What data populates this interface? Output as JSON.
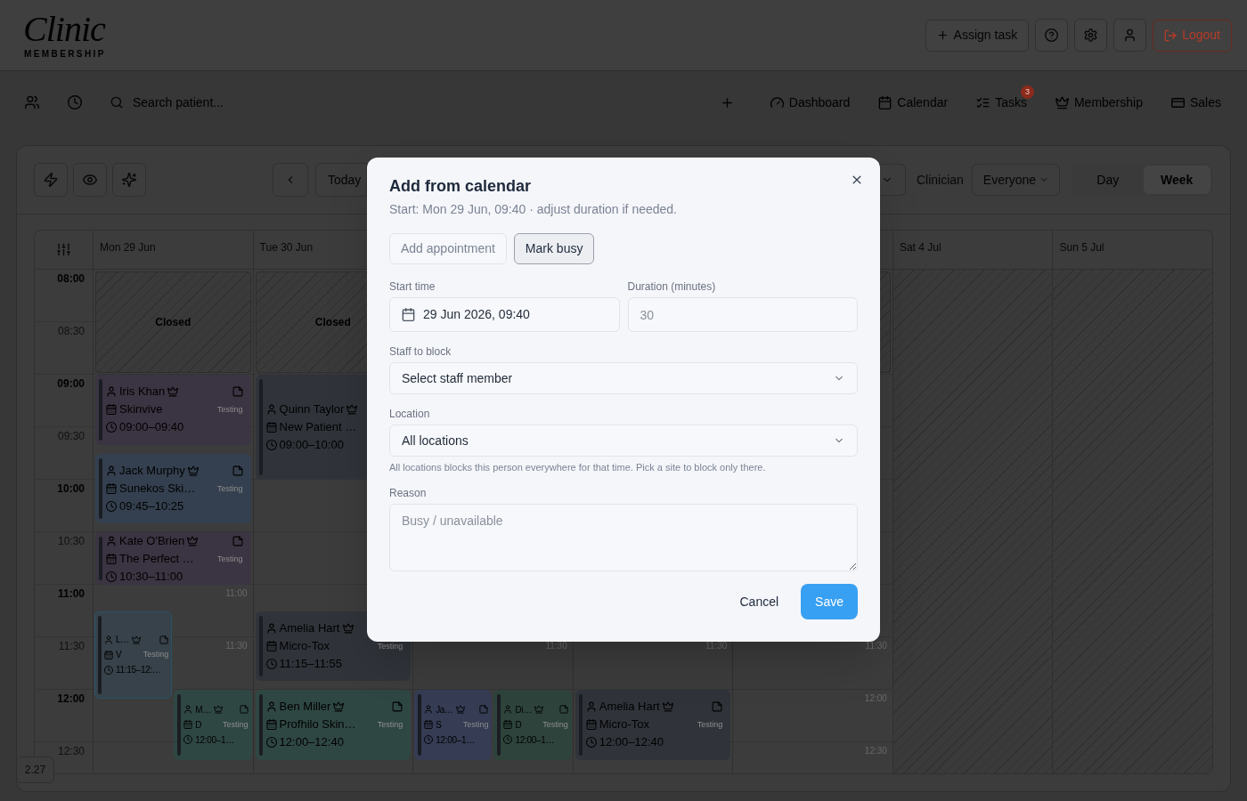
{
  "header": {
    "logo": {
      "wordmark": "Clinic",
      "tagline": "MEMBERSHIP"
    },
    "actions": [
      {
        "kind": "assign",
        "label": "Assign task"
      },
      {
        "kind": "help"
      },
      {
        "kind": "settings"
      },
      {
        "kind": "account"
      },
      {
        "kind": "logout",
        "label": "Logout"
      }
    ]
  },
  "nav": {
    "left": [
      {
        "kind": "patients"
      },
      {
        "kind": "history"
      }
    ],
    "search": {
      "placeholder": "Search patient..."
    },
    "links": [
      {
        "kind": "add"
      },
      {
        "kind": "dashboard",
        "label": "Dashboard"
      },
      {
        "kind": "calendar",
        "label": "Calendar"
      },
      {
        "kind": "tasks",
        "label": "Tasks",
        "badge": "3"
      },
      {
        "kind": "membership",
        "label": "Membership"
      },
      {
        "kind": "sales",
        "label": "Sales"
      }
    ]
  },
  "toolbar": {
    "tools": [
      {
        "kind": "quick-actions"
      },
      {
        "kind": "visibility"
      },
      {
        "kind": "ai"
      }
    ],
    "navigation": [
      {
        "kind": "prev"
      },
      {
        "kind": "today",
        "label": "Today"
      }
    ],
    "filters": [
      {
        "kind": "select"
      },
      {
        "kind": "label",
        "label": "Clinician"
      },
      {
        "kind": "select",
        "value": "Everyone"
      }
    ],
    "views": [
      {
        "label": "Day",
        "selected": false
      },
      {
        "label": "Week",
        "selected": true
      }
    ]
  },
  "calendar": {
    "times": [
      {
        "label": "08:00",
        "kind": "hour"
      },
      {
        "label": "08:30",
        "kind": "half"
      },
      {
        "label": "09:00",
        "kind": "hour"
      },
      {
        "label": "09:30",
        "kind": "half"
      },
      {
        "label": "10:00",
        "kind": "hour"
      },
      {
        "label": "10:30",
        "kind": "half"
      },
      {
        "label": "11:00",
        "kind": "hour"
      },
      {
        "label": "11:30",
        "kind": "half"
      },
      {
        "label": "12:00",
        "kind": "hour"
      },
      {
        "label": "12:30",
        "kind": "half"
      }
    ],
    "days": [
      {
        "label": "Mon 29 Jun",
        "closed_morning": true,
        "closed_label": "Closed",
        "slot_hints": [
          "11:00",
          "11:30"
        ],
        "events": [
          {
            "name": "Iris Khan",
            "member": true,
            "note": true,
            "treatment": "Skinvive",
            "tag": "Testing",
            "time": "09:00–09:40",
            "color": "#3b3442",
            "selected": false
          },
          {
            "name": "Jack Murphy",
            "member": true,
            "note": true,
            "treatment": "Sunekos Ski…",
            "tag": "Testing",
            "time": "09:45–10:25",
            "color": "#34404f",
            "selected": false
          },
          {
            "name": "Kate O'Brien",
            "member": true,
            "note": true,
            "treatment": "The Perfect …",
            "tag": "Testing",
            "time": "10:30–11:00",
            "color": "#3b3442",
            "selected": false
          },
          {
            "name": "L…",
            "member": true,
            "note": true,
            "treatment": "V",
            "tag": "Testing",
            "time": "11:15–12:…",
            "color": "#37424a",
            "selected": true
          },
          {
            "name": "M…",
            "member": true,
            "note": true,
            "treatment": "D",
            "tag": "Testing",
            "time": "12:00–1…",
            "color": "#2f4743",
            "selected": false
          }
        ]
      },
      {
        "label": "Tue 30 Jun",
        "closed_morning": true,
        "closed_label": "Closed",
        "events": [
          {
            "name": "Quinn Taylor",
            "member": true,
            "treatment": "New Patient …",
            "time": "09:00–10:00",
            "color": "#30343a",
            "selected": false
          },
          {
            "name": "Amelia Hart",
            "member": true,
            "treatment": "Micro-Tox",
            "tag": "Testing",
            "time": "11:15–11:55",
            "color": "#30343a",
            "selected": false
          },
          {
            "name": "Ben Miller",
            "member": true,
            "note": true,
            "treatment": "Profhilo Skin…",
            "tag": "Testing",
            "time": "12:00–12:40",
            "color": "#2f4743",
            "selected": false
          }
        ]
      },
      {
        "slot_hints": [
          "11:30"
        ],
        "events": [
          {
            "name": "Ja…",
            "member": true,
            "note": true,
            "treatment": "S",
            "tag": "Testing",
            "time": "12:00–1…",
            "color": "#353c53",
            "selected": false
          },
          {
            "name": "Di…",
            "member": true,
            "note": true,
            "treatment": "D",
            "tag": "Testing",
            "time": "12:00–1…",
            "color": "#2d433b",
            "selected": false
          }
        ]
      },
      {
        "slot_hints": [
          "11:30"
        ],
        "events": [
          {
            "name": "Amelia Hart",
            "member": true,
            "note": true,
            "treatment": "Micro-Tox",
            "tag": "Testing",
            "time": "12:00–12:40",
            "color": "#30343a",
            "selected": false
          }
        ]
      },
      {
        "closed_morning": true,
        "slot_hints": [
          "11:30",
          "12:00",
          "12:30"
        ]
      },
      {
        "label": "Sat 4 Jul",
        "closed_all_day": true
      },
      {
        "label": "Sun 5 Jul",
        "closed_all_day": true
      }
    ]
  },
  "version": "2.27",
  "modal": {
    "title": "Add from calendar",
    "subtitle": "Start: Mon 29 Jun, 09:40 · adjust duration if needed.",
    "modes": [
      {
        "label": "Add appointment",
        "selected": false
      },
      {
        "label": "Mark busy",
        "selected": true
      }
    ],
    "fields": [
      {
        "kind": "datetime",
        "label": "Start time",
        "value": "29 Jun 2026, 09:40"
      },
      {
        "kind": "number",
        "label": "Duration (minutes)",
        "placeholder": "30"
      },
      {
        "kind": "select",
        "label": "Staff to block",
        "value": "Select staff member"
      },
      {
        "kind": "select",
        "label": "Location",
        "value": "All locations",
        "help": "All locations blocks this person everywhere for that time. Pick a site to block only there."
      },
      {
        "kind": "textarea",
        "label": "Reason",
        "placeholder": "Busy / unavailable"
      }
    ],
    "buttons": [
      {
        "kind": "cancel",
        "label": "Cancel"
      },
      {
        "kind": "save",
        "label": "Save"
      }
    ]
  }
}
